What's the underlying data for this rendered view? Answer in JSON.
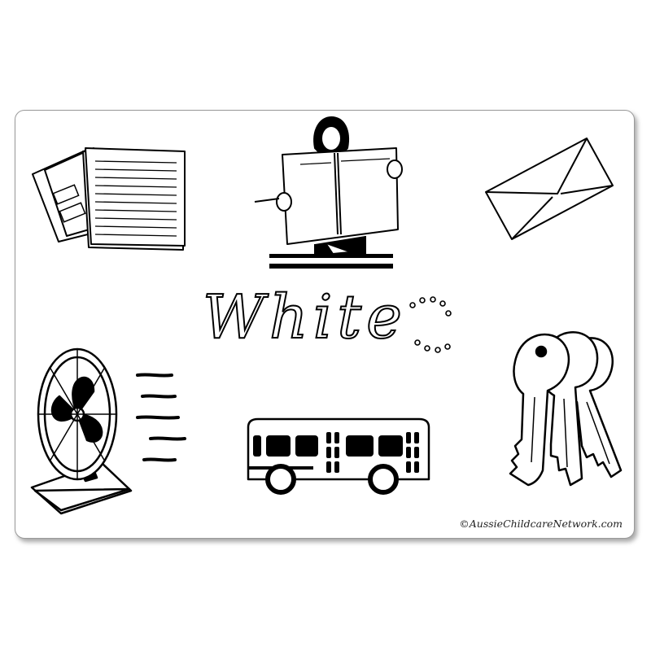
{
  "title": "White",
  "copyright": "©AussieChildcareNetwork.com",
  "pictures": {
    "paper": "paper-icon",
    "newspaper": "newspaper-reader-icon",
    "envelope": "envelope-icon",
    "fan": "electric-fan-icon",
    "bus": "bus-icon",
    "keys": "keys-icon"
  },
  "colors": {
    "ink": "#000000",
    "background": "#ffffff",
    "border": "#9a9a9a"
  }
}
